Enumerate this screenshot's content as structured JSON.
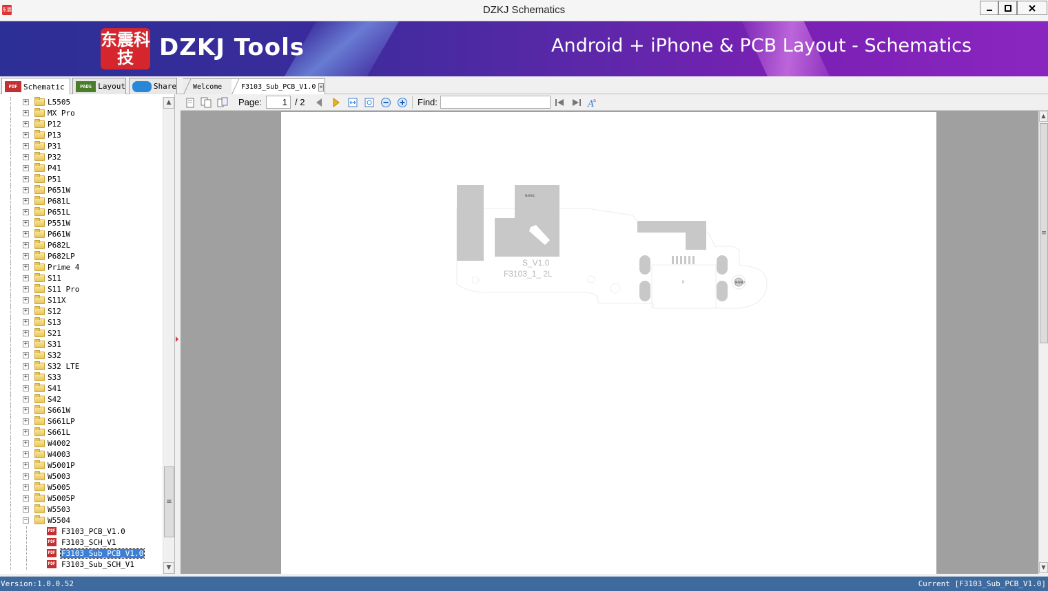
{
  "window": {
    "title": "DZKJ Schematics",
    "icon_text": "东震"
  },
  "banner": {
    "logo_text": "东震科技",
    "brand": "DZKJ Tools",
    "tagline": "Android + iPhone & PCB Layout - Schematics"
  },
  "mode_tabs": {
    "schematic": "Schematic",
    "schematic_icon": "PDF",
    "layout": "Layout",
    "layout_icon": "PADS",
    "share": "Share"
  },
  "doc_tabs": {
    "welcome": "Welcome",
    "current": "F3103_Sub_PCB_V1.0"
  },
  "tree": {
    "folders": [
      "L5505",
      "MX Pro",
      "P12",
      "P13",
      "P31",
      "P32",
      "P41",
      "P51",
      "P651W",
      "P681L",
      "P651L",
      "P551W",
      "P661W",
      "P682L",
      "P682LP",
      "Prime 4",
      "S11",
      "S11 Pro",
      "S11X",
      "S12",
      "S13",
      "S21",
      "S31",
      "S32",
      "S32 LTE",
      "S33",
      "S41",
      "S42",
      "S661W",
      "S661LP",
      "S661L",
      "W4002",
      "W4003",
      "W5001P",
      "W5003",
      "W5005",
      "W5005P",
      "W5503"
    ],
    "expanded_folder": "W5504",
    "files": [
      {
        "label": "F3103_PCB_V1.0",
        "selected": false
      },
      {
        "label": "F3103_SCH_V1",
        "selected": false
      },
      {
        "label": "F3103_Sub_PCB_V1.0",
        "selected": true
      },
      {
        "label": "F3103_Sub_SCH_V1",
        "selected": false
      }
    ]
  },
  "toolbar": {
    "page_label": "Page:",
    "page_value": "1",
    "page_total": "/ 2",
    "find_label": "Find:",
    "find_value": ""
  },
  "document": {
    "pcb_text_1": "S_V1.0",
    "pcb_text_2": "F3103_1_ 2L",
    "pcb_mark_1": "MARK1",
    "pcb_mark_2": "MARK2"
  },
  "status": {
    "version": "Version:1.0.0.52",
    "current": "Current [F3103_Sub_PCB_V1.0]"
  }
}
